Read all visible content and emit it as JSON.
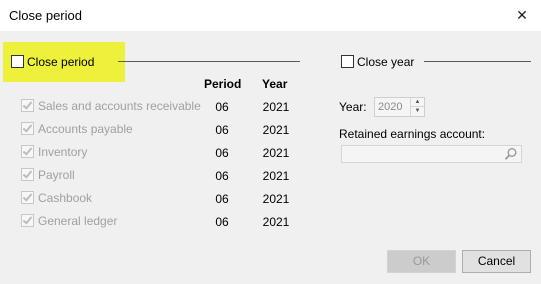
{
  "window": {
    "title": "Close period",
    "close_glyph": "✕"
  },
  "close_period": {
    "label": "Close period",
    "checked": false,
    "highlight_color": "#eef13b"
  },
  "close_year": {
    "label": "Close year",
    "checked": false
  },
  "table": {
    "headers": {
      "period": "Period",
      "year": "Year"
    },
    "rows": [
      {
        "label": "Sales and accounts receivable",
        "period": "06",
        "year": "2021",
        "checked": true
      },
      {
        "label": "Accounts payable",
        "period": "06",
        "year": "2021",
        "checked": true
      },
      {
        "label": "Inventory",
        "period": "06",
        "year": "2021",
        "checked": true
      },
      {
        "label": "Payroll",
        "period": "06",
        "year": "2021",
        "checked": true
      },
      {
        "label": "Cashbook",
        "period": "06",
        "year": "2021",
        "checked": true
      },
      {
        "label": "General ledger",
        "period": "06",
        "year": "2021",
        "checked": true
      }
    ]
  },
  "year_panel": {
    "year_label": "Year:",
    "year_value": "2020",
    "retained_label": "Retained earnings account:",
    "retained_value": ""
  },
  "buttons": {
    "ok": "OK",
    "cancel": "Cancel"
  }
}
